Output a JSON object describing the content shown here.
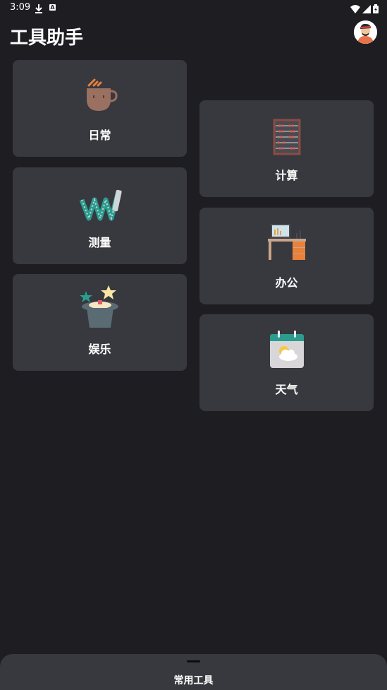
{
  "status_bar": {
    "time": "3:09",
    "badge": "A"
  },
  "app": {
    "title": "工具助手"
  },
  "categories": {
    "daily": "日常",
    "calc": "计算",
    "measure": "测量",
    "office": "办公",
    "entertainment": "娱乐",
    "weather": "天气"
  },
  "bottom_sheet": {
    "title": "常用工具"
  },
  "colors": {
    "background": "#1e1e22",
    "card": "#38383f",
    "text": "#ffffff"
  },
  "icons": [
    "download-icon",
    "a-badge-icon",
    "wifi-icon",
    "signal-icon",
    "battery-icon",
    "coffee-cup-icon",
    "abacus-icon",
    "tape-measure-icon",
    "office-desk-icon",
    "magic-hat-icon",
    "weather-calendar-icon"
  ]
}
